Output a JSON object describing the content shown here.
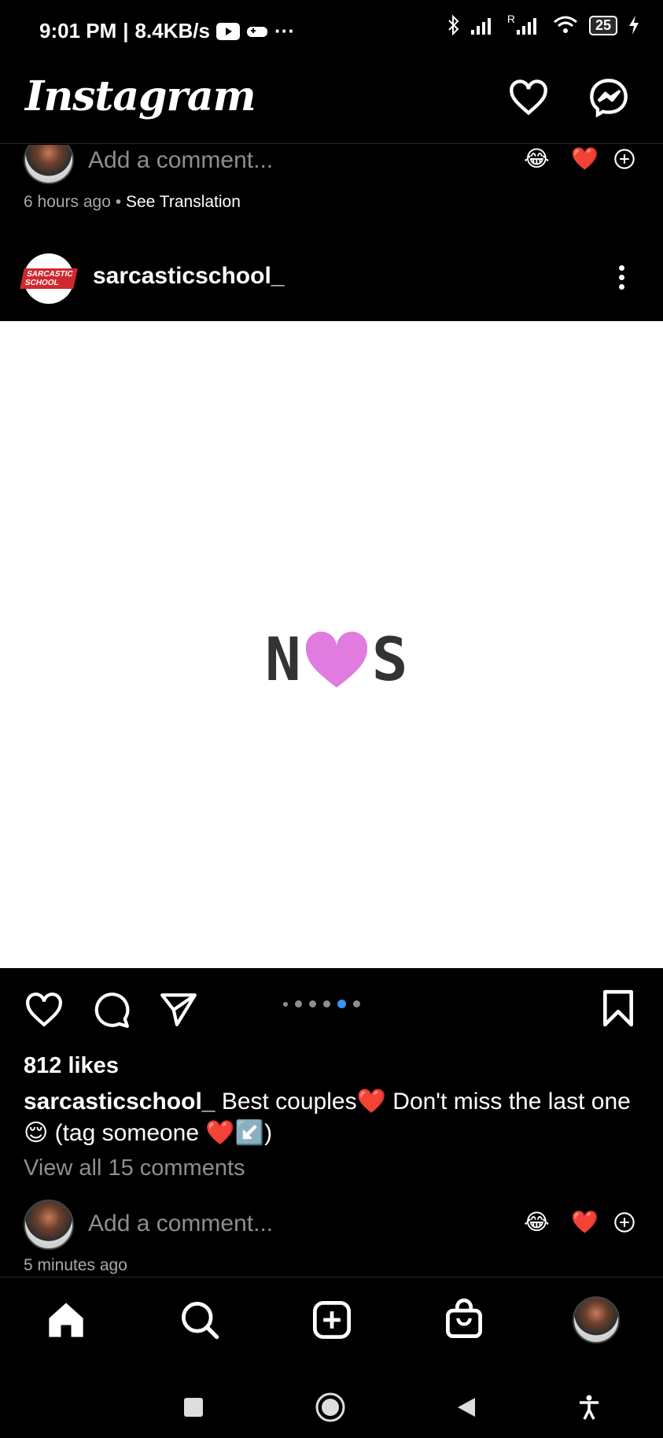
{
  "status_bar": {
    "time": "9:01 PM",
    "speed": "8.4KB/s",
    "more": "···",
    "battery": "25",
    "roaming": "R"
  },
  "header": {
    "logo": "Instagram"
  },
  "previous_post": {
    "comment_placeholder": "Add a comment...",
    "reactions": [
      "😂",
      "❤️"
    ],
    "time": "6 hours ago",
    "separator": "•",
    "translation": "See Translation"
  },
  "post": {
    "username": "sarcasticschool_",
    "avatar_text": "SARCASTIC SCHOOL",
    "image": {
      "left_letter": "N",
      "right_letter": "S",
      "heart_color": "#e07be0"
    },
    "likes": "812 likes",
    "caption_user": "sarcasticschool_",
    "caption_text": " Best couples❤️ Don't miss the last one😌 (tag someone ❤️↙️)",
    "view_comments": "View all 15 comments",
    "comment_placeholder": "Add a comment...",
    "reactions": [
      "😂",
      "❤️"
    ],
    "time": "5 minutes ago",
    "carousel": {
      "count": 6,
      "active_index": 4
    }
  }
}
